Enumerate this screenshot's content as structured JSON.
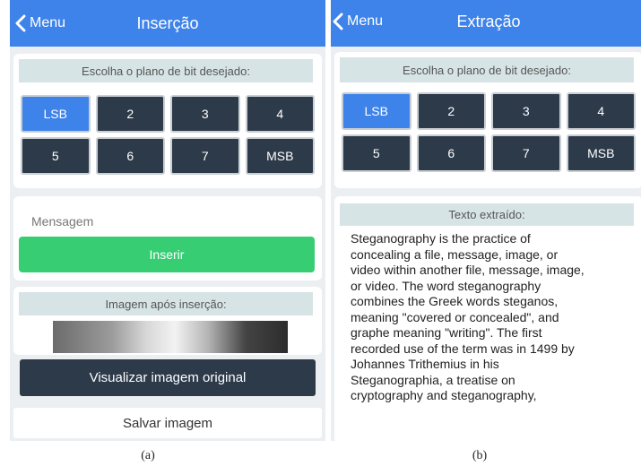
{
  "insertion": {
    "back_label": "Menu",
    "title": "Inserção",
    "bit_plane_heading": "Escolha o plano de bit desejado:",
    "bits": [
      "LSB",
      "2",
      "3",
      "4",
      "5",
      "6",
      "7",
      "MSB"
    ],
    "selected_bit": "LSB",
    "message_placeholder": "Mensagem",
    "insert_button": "Inserir",
    "image_heading": "Imagem após inserção:",
    "view_original_button": "Visualizar imagem original",
    "save_button": "Salvar imagem",
    "caption": "(a)"
  },
  "extraction": {
    "back_label": "Menu",
    "title": "Extração",
    "bit_plane_heading": "Escolha o plano de bit desejado:",
    "bits": [
      "LSB",
      "2",
      "3",
      "4",
      "5",
      "6",
      "7",
      "MSB"
    ],
    "selected_bit": "LSB",
    "text_heading": "Texto extraído:",
    "extracted_lines": [
      "Steganography is the practice of",
      "concealing a file, message, image, or",
      "video within another file, message, image,",
      "or video. The word steganography",
      "combines the Greek words steganos,",
      "meaning \"covered or concealed\", and",
      "graphe meaning \"writing\". The first",
      "recorded use of the term was in 1499 by",
      "Johannes Trithemius in his",
      "Steganographia, a treatise on",
      "cryptography and steganography,"
    ],
    "caption": "(b)"
  },
  "colors": {
    "navbar": "#3e83e9",
    "bit_button": "#2d3a4a",
    "bit_selected": "#3e83e9",
    "insert_button": "#37cd73",
    "section_head": "#d7e4e6"
  }
}
